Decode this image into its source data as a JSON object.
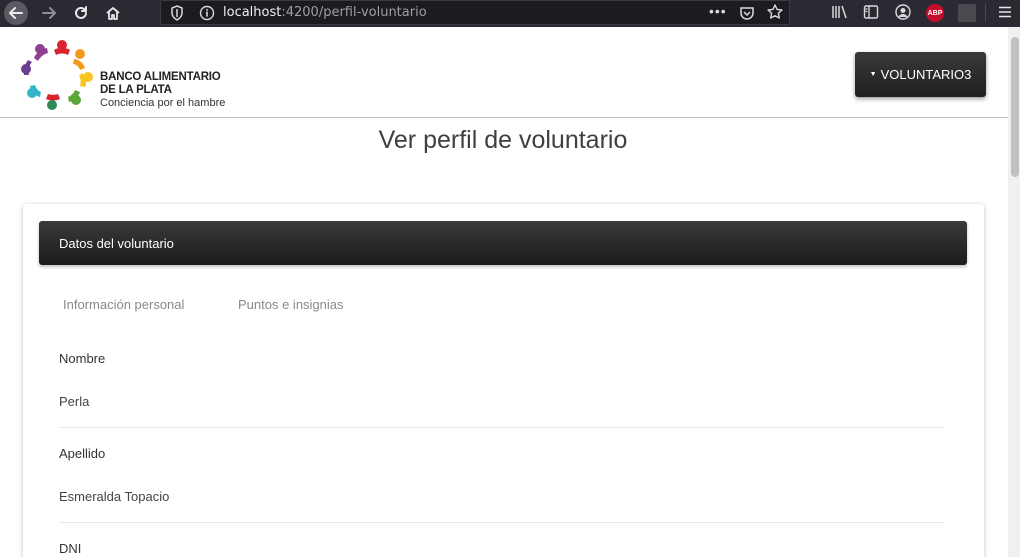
{
  "browser": {
    "url_host": "localhost",
    "url_path": ":4200/perfil-voluntario",
    "more_glyph": "•••",
    "extension_abp": "ABP"
  },
  "header": {
    "brand_line1": "BANCO ALIMENTARIO",
    "brand_line2": "DE LA PLATA",
    "brand_tagline": "Conciencia por el hambre",
    "user_button_label": "VOLUNTARIO3",
    "user_button_caret": "▼"
  },
  "page": {
    "title": "Ver perfil de voluntario"
  },
  "card": {
    "header_title": "Datos del voluntario",
    "tabs": [
      {
        "label": "Información personal"
      },
      {
        "label": "Puntos e insignias"
      }
    ],
    "fields": [
      {
        "label": "Nombre",
        "value": "Perla"
      },
      {
        "label": "Apellido",
        "value": "Esmeralda Topacio"
      },
      {
        "label": "DNI",
        "value": ""
      }
    ]
  },
  "colors": {
    "chrome_bg": "#2b2a33",
    "dark_button": "#2a2a2a",
    "logo_red": "#d9232d",
    "logo_orange": "#f39a1e",
    "logo_yellow": "#f7c51e",
    "logo_green": "#5aa83a",
    "logo_teal": "#34b5c8",
    "logo_purple": "#6b3f8e"
  }
}
